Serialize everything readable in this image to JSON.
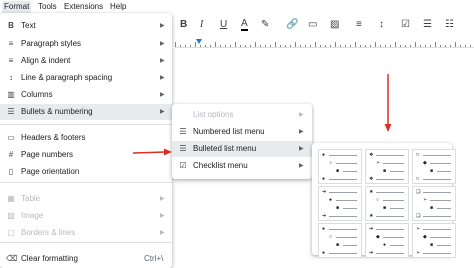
{
  "menubar": {
    "items": [
      "Format",
      "Tools",
      "Extensions",
      "Help"
    ]
  },
  "toolbar": {
    "bold": "B",
    "italic": "I",
    "underline": "U",
    "text_color": "A"
  },
  "format_menu": {
    "items": [
      {
        "icon": "B",
        "label": "Text",
        "submenu": true,
        "disabled": false
      },
      {
        "icon": "≡",
        "label": "Paragraph styles",
        "submenu": true,
        "disabled": false
      },
      {
        "icon": "≡",
        "label": "Align & indent",
        "submenu": true,
        "disabled": false
      },
      {
        "icon": "↕",
        "label": "Line & paragraph spacing",
        "submenu": true,
        "disabled": false
      },
      {
        "icon": "▥",
        "label": "Columns",
        "submenu": true,
        "disabled": false
      },
      {
        "icon": "☰",
        "label": "Bullets & numbering",
        "submenu": true,
        "disabled": false
      },
      {
        "icon": "▭",
        "label": "Headers & footers",
        "submenu": false,
        "disabled": false
      },
      {
        "icon": "#",
        "label": "Page numbers",
        "submenu": false,
        "disabled": false
      },
      {
        "icon": "▯",
        "label": "Page orientation",
        "submenu": false,
        "disabled": false
      },
      {
        "icon": "▦",
        "label": "Table",
        "submenu": true,
        "disabled": true
      },
      {
        "icon": "▨",
        "label": "Image",
        "submenu": true,
        "disabled": true
      },
      {
        "icon": "▢",
        "label": "Borders & lines",
        "submenu": true,
        "disabled": true
      },
      {
        "icon": "⌫",
        "label": "Clear formatting",
        "shortcut": "Ctrl+\\",
        "submenu": false,
        "disabled": false
      }
    ]
  },
  "bullets_submenu": {
    "items": [
      {
        "icon": "",
        "label": "List options",
        "disabled": true
      },
      {
        "icon": "☰",
        "label": "Numbered list menu",
        "disabled": false
      },
      {
        "icon": "☰",
        "label": "Bulleted list menu",
        "disabled": false
      },
      {
        "icon": "☑",
        "label": "Checklist menu",
        "disabled": false
      }
    ]
  },
  "bullet_presets": [
    [
      "●",
      "○",
      "■"
    ],
    [
      "❖",
      "➢",
      "■"
    ],
    [
      "□",
      "◆",
      "■"
    ],
    [
      "➔",
      "●",
      "■"
    ],
    [
      "★",
      "○",
      "■"
    ],
    [
      "❑",
      "➢",
      "■"
    ],
    [
      "●",
      "○",
      "■"
    ],
    [
      "➔",
      "◆",
      "●"
    ],
    [
      "➢",
      "◆",
      "■"
    ]
  ],
  "colors": {
    "accent": "#1a73e8",
    "arrow": "#d93025",
    "highlight": "#e8eaed",
    "disabled": "#b7b9bd"
  }
}
